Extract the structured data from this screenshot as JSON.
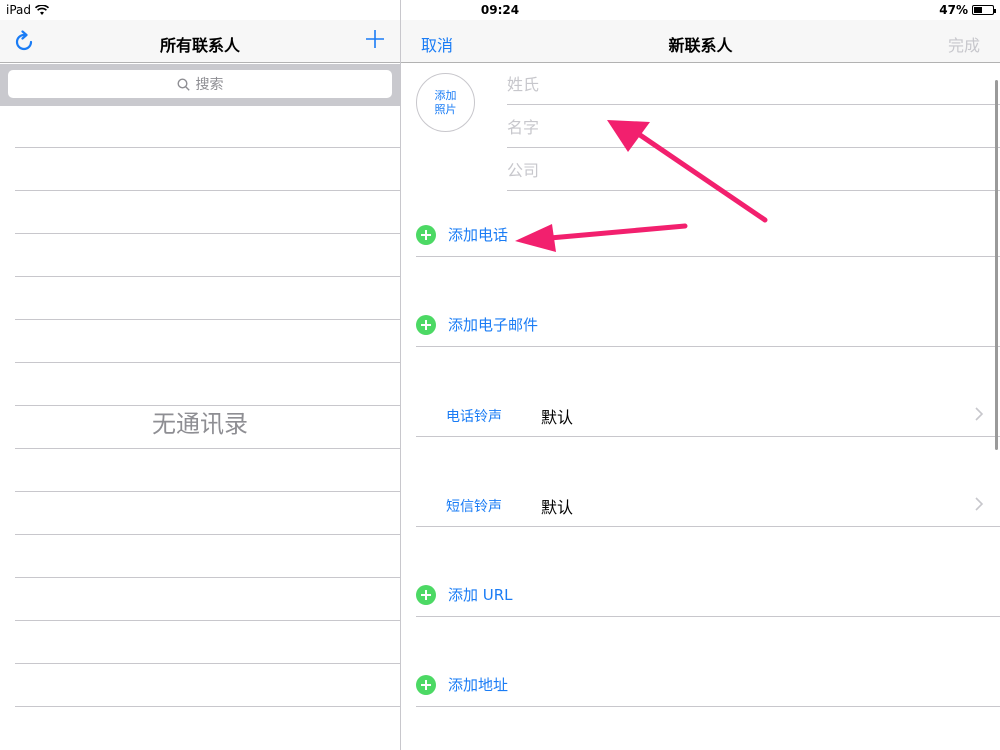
{
  "status_bar": {
    "device": "iPad",
    "time": "09:24",
    "battery_text": "47%",
    "battery_level": 0.47
  },
  "left_pane": {
    "title": "所有联系人",
    "refresh_icon": "refresh-icon",
    "add_icon": "plus-icon",
    "search_placeholder": "搜索",
    "empty_text": "无通讯录"
  },
  "right_pane": {
    "cancel_label": "取消",
    "title": "新联系人",
    "done_label": "完成",
    "photo": {
      "line1": "添加",
      "line2": "照片"
    },
    "fields": {
      "last_name_placeholder": "姓氏",
      "first_name_placeholder": "名字",
      "company_placeholder": "公司"
    },
    "add_phone_label": "添加电话",
    "add_email_label": "添加电子邮件",
    "ringtone": {
      "label": "电话铃声",
      "value": "默认"
    },
    "text_tone": {
      "label": "短信铃声",
      "value": "默认"
    },
    "add_url_label": "添加 URL",
    "add_address_label": "添加地址"
  },
  "colors": {
    "accent": "#1a7cf5",
    "add_green": "#4cd964",
    "annotation_arrow": "#f2206e"
  }
}
